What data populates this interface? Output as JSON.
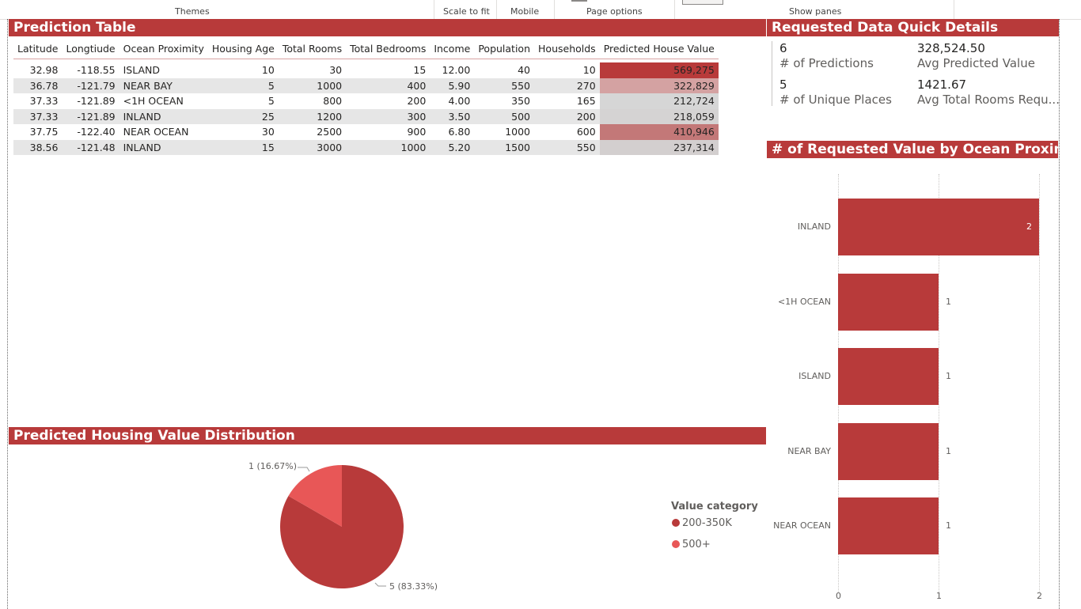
{
  "ribbon": {
    "themes": "Themes",
    "scale_to_fit": "Scale to fit",
    "mobile": "Mobile",
    "page_options": "Page options",
    "show_panes": "Show panes"
  },
  "prediction_table": {
    "title": "Prediction Table",
    "columns": [
      "Latitude",
      "Longtiude",
      "Ocean Proximity",
      "Housing Age",
      "Total Rooms",
      "Total Bedrooms",
      "Income",
      "Population",
      "Households",
      "Predicted House Value"
    ],
    "rows": [
      [
        "32.98",
        "-118.55",
        "ISLAND",
        "10",
        "30",
        "15",
        "12.00",
        "40",
        "10",
        "569,275"
      ],
      [
        "36.78",
        "-121.79",
        "NEAR BAY",
        "5",
        "1000",
        "400",
        "5.90",
        "550",
        "270",
        "322,829"
      ],
      [
        "37.33",
        "-121.89",
        "<1H OCEAN",
        "5",
        "800",
        "200",
        "4.00",
        "350",
        "165",
        "212,724"
      ],
      [
        "37.33",
        "-121.89",
        "INLAND",
        "25",
        "1200",
        "300",
        "3.50",
        "500",
        "200",
        "218,059"
      ],
      [
        "37.75",
        "-122.40",
        "NEAR OCEAN",
        "30",
        "2500",
        "900",
        "6.80",
        "1000",
        "600",
        "410,946"
      ],
      [
        "38.56",
        "-121.48",
        "INLAND",
        "15",
        "3000",
        "1000",
        "5.20",
        "1500",
        "550",
        "237,314"
      ]
    ],
    "value_colors": [
      "#b83a3a",
      "#d4a2a2",
      "#d6d6d6",
      "#d5d3d3",
      "#c37878",
      "#d3cfcf"
    ]
  },
  "quick_details": {
    "title": "Requested Data Quick Details",
    "num_predictions": "6",
    "num_predictions_label": "# of Predictions",
    "avg_predicted_value": "328,524.50",
    "avg_predicted_value_label": "Avg Predicted Value",
    "num_unique_places": "5",
    "num_unique_places_label": "# of Unique Places",
    "avg_total_rooms": "1421.67",
    "avg_total_rooms_label": "Avg Total Rooms Requ..."
  },
  "bar_chart_header": "# of Requested Value by Ocean Proximity",
  "pie_header": "Predicted Housing Value Distribution",
  "chart_data": [
    {
      "type": "bar",
      "orientation": "horizontal",
      "title": "# of Requested Value by Ocean Proximity",
      "categories": [
        "INLAND",
        "<1H OCEAN",
        "ISLAND",
        "NEAR BAY",
        "NEAR OCEAN"
      ],
      "values": [
        2,
        1,
        1,
        1,
        1
      ],
      "data_labels": [
        "2",
        "1",
        "1",
        "1",
        "1"
      ],
      "xlim": [
        0,
        2
      ],
      "x_ticks": [
        "0",
        "1",
        "2"
      ],
      "grid": true,
      "color": "#b83a3a"
    },
    {
      "type": "pie",
      "title": "Predicted Housing Value Distribution",
      "legend_title": "Value category",
      "legend_position": "right",
      "slices": [
        {
          "name": "200-350K",
          "value": 5,
          "label": "5 (83.33%)",
          "color": "#b83a3a"
        },
        {
          "name": "500+",
          "value": 1,
          "label": "1 (16.67%)",
          "color": "#e85757"
        }
      ]
    }
  ]
}
